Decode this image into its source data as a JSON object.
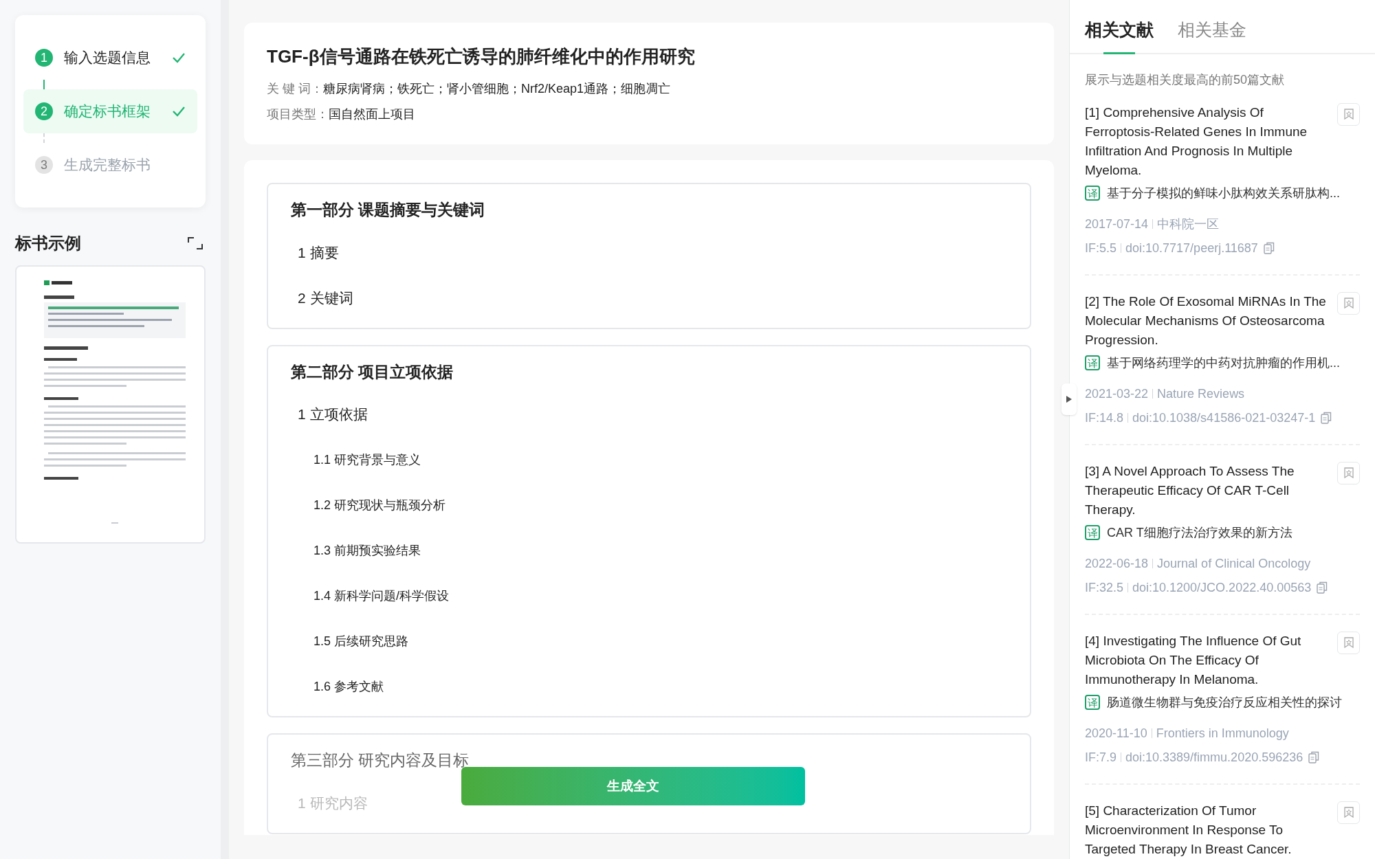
{
  "steps": [
    {
      "number": "1",
      "label": "输入选题信息",
      "done": true,
      "selected": false
    },
    {
      "number": "2",
      "label": "确定标书框架",
      "done": true,
      "selected": true
    },
    {
      "number": "3",
      "label": "生成完整标书",
      "done": false,
      "selected": false
    }
  ],
  "example": {
    "title": "标书示例"
  },
  "project": {
    "title": "TGF-β信号通路在铁死亡诱导的肺纤维化中的作用研究",
    "keywords_label": "关 键 词：",
    "keywords": "糖尿病肾病；铁死亡；肾小管细胞；Nrf2/Keap1通路；细胞凋亡",
    "type_label": "项目类型：",
    "type": "国自然面上项目"
  },
  "outline": [
    {
      "title": "第一部分 课题摘要与关键词",
      "faded": false,
      "children": [
        {
          "label": "1 摘要"
        },
        {
          "label": "2 关键词"
        }
      ]
    },
    {
      "title": "第二部分 项目立项依据",
      "faded": false,
      "children": [
        {
          "label": "1 立项依据",
          "children": [
            {
              "label": "1.1 研究背景与意义"
            },
            {
              "label": "1.2 研究现状与瓶颈分析"
            },
            {
              "label": "1.3 前期预实验结果"
            },
            {
              "label": "1.4 新科学问题/科学假设"
            },
            {
              "label": "1.5 后续研究思路"
            },
            {
              "label": "1.6 参考文献"
            }
          ]
        }
      ]
    },
    {
      "title": "第三部分 研究内容及目标",
      "faded": true,
      "children": [
        {
          "label": "1 研究内容"
        }
      ]
    }
  ],
  "generate_button": "生成全文",
  "tabs": [
    {
      "label": "相关文献",
      "selected": true
    },
    {
      "label": "相关基金",
      "selected": false
    }
  ],
  "literature_hint": "展示与选题相关度最高的前50篇文献",
  "papers": [
    {
      "title": "[1] Comprehensive Analysis Of Ferroptosis-Related Genes In Immune Infiltration And Prognosis In Multiple Myeloma.",
      "translate_badge": "译",
      "translation": "基于分子模拟的鲜味小肽构效关系研肽构...",
      "date": "2017-07-14",
      "source": "中科院一区",
      "impact": "IF:5.5",
      "doi": "doi:10.7717/peerj.11687"
    },
    {
      "title": "[2] The Role Of Exosomal MiRNAs In The Molecular Mechanisms Of Osteosarcoma Progression.",
      "translate_badge": "译",
      "translation": "基于网络药理学的中药对抗肿瘤的作用机...",
      "date": "2021-03-22",
      "source": "Nature Reviews",
      "impact": "IF:14.8",
      "doi": "doi:10.1038/s41586-021-03247-1"
    },
    {
      "title": "[3] A Novel Approach To Assess The Therapeutic Efficacy Of CAR T-Cell Therapy.",
      "translate_badge": "译",
      "translation": "CAR T细胞疗法治疗效果的新方法",
      "date": "2022-06-18",
      "source": "Journal of Clinical Oncology",
      "impact": "IF:32.5",
      "doi": "doi:10.1200/JCO.2022.40.00563"
    },
    {
      "title": "[4] Investigating The Influence Of Gut Microbiota On The Efficacy Of Immunotherapy In Melanoma.",
      "translate_badge": "译",
      "translation": "肠道微生物群与免疫治疗反应相关性的探讨",
      "date": "2020-11-10",
      "source": "Frontiers in Immunology",
      "impact": "IF:7.9",
      "doi": "doi:10.3389/fimmu.2020.596236"
    },
    {
      "title": "[5] Characterization Of Tumor Microenvironment In Response To Targeted Therapy In Breast Cancer."
    }
  ]
}
